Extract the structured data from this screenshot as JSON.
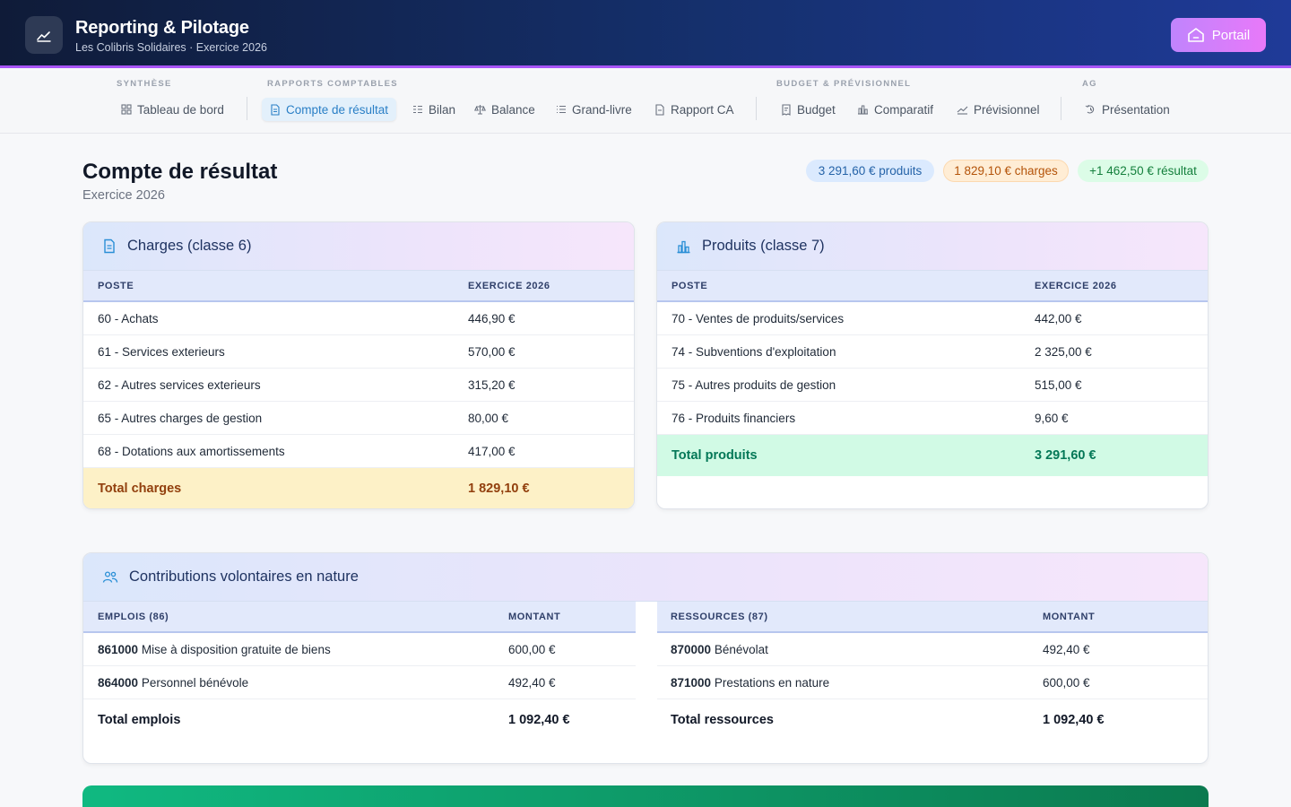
{
  "app": {
    "title": "Reporting & Pilotage",
    "subtitle": "Les Colibris Solidaires · Exercice 2026",
    "portal_label": "Portail"
  },
  "nav": {
    "groups": [
      "SYNTHÈSE",
      "RAPPORTS COMPTABLES",
      "BUDGET & PRÉVISIONNEL",
      "AG"
    ],
    "items": [
      {
        "label": "Tableau de bord",
        "icon": "grid-icon"
      },
      {
        "label": "Compte de résultat",
        "icon": "document-icon",
        "active": true
      },
      {
        "label": "Bilan",
        "icon": "list-icon"
      },
      {
        "label": "Balance",
        "icon": "scale-icon"
      },
      {
        "label": "Grand-livre",
        "icon": "lines-icon"
      },
      {
        "label": "Rapport CA",
        "icon": "file-icon"
      },
      {
        "label": "Budget",
        "icon": "receipt-icon"
      },
      {
        "label": "Comparatif",
        "icon": "bar-chart-icon"
      },
      {
        "label": "Prévisionnel",
        "icon": "trend-icon"
      },
      {
        "label": "Présentation",
        "icon": "present-icon"
      }
    ]
  },
  "page": {
    "title": "Compte de résultat",
    "subtitle": "Exercice 2026",
    "badges": {
      "produits": "3 291,60 € produits",
      "charges": "1 829,10 € charges",
      "resultat": "+1 462,50 € résultat"
    }
  },
  "charges": {
    "title": "Charges (classe 6)",
    "col1": "POSTE",
    "col2": "EXERCICE 2026",
    "rows": [
      {
        "poste": "60 - Achats",
        "montant": "446,90 €"
      },
      {
        "poste": "61 - Services exterieurs",
        "montant": "570,00 €"
      },
      {
        "poste": "62 - Autres services exterieurs",
        "montant": "315,20 €"
      },
      {
        "poste": "65 - Autres charges de gestion",
        "montant": "80,00 €"
      },
      {
        "poste": "68 - Dotations aux amortissements",
        "montant": "417,00 €"
      }
    ],
    "total_label": "Total charges",
    "total_value": "1 829,10 €"
  },
  "produits": {
    "title": "Produits (classe 7)",
    "col1": "POSTE",
    "col2": "EXERCICE 2026",
    "rows": [
      {
        "poste": "70 - Ventes de produits/services",
        "montant": "442,00 €"
      },
      {
        "poste": "74 - Subventions d'exploitation",
        "montant": "2 325,00 €"
      },
      {
        "poste": "75 - Autres produits de gestion",
        "montant": "515,00 €"
      },
      {
        "poste": "76 - Produits financiers",
        "montant": "9,60 €"
      }
    ],
    "total_label": "Total produits",
    "total_value": "3 291,60 €"
  },
  "cvn": {
    "title": "Contributions volontaires en nature",
    "emplois": {
      "col1": "EMPLOIS (86)",
      "col2": "MONTANT",
      "rows": [
        {
          "code": "861000",
          "label": "Mise à disposition gratuite de biens",
          "montant": "600,00 €"
        },
        {
          "code": "864000",
          "label": "Personnel bénévole",
          "montant": "492,40 €"
        }
      ],
      "total_label": "Total emplois",
      "total_value": "1 092,40 €"
    },
    "ressources": {
      "col1": "RESSOURCES (87)",
      "col2": "MONTANT",
      "rows": [
        {
          "code": "870000",
          "label": "Bénévolat",
          "montant": "492,40 €"
        },
        {
          "code": "871000",
          "label": "Prestations en nature",
          "montant": "600,00 €"
        }
      ],
      "total_label": "Total ressources",
      "total_value": "1 092,40 €"
    }
  },
  "colors": {
    "accent": "#2a7fc6",
    "header_start": "#0f1b38",
    "header_end": "#1f3a98",
    "portal": "#d889f8"
  }
}
